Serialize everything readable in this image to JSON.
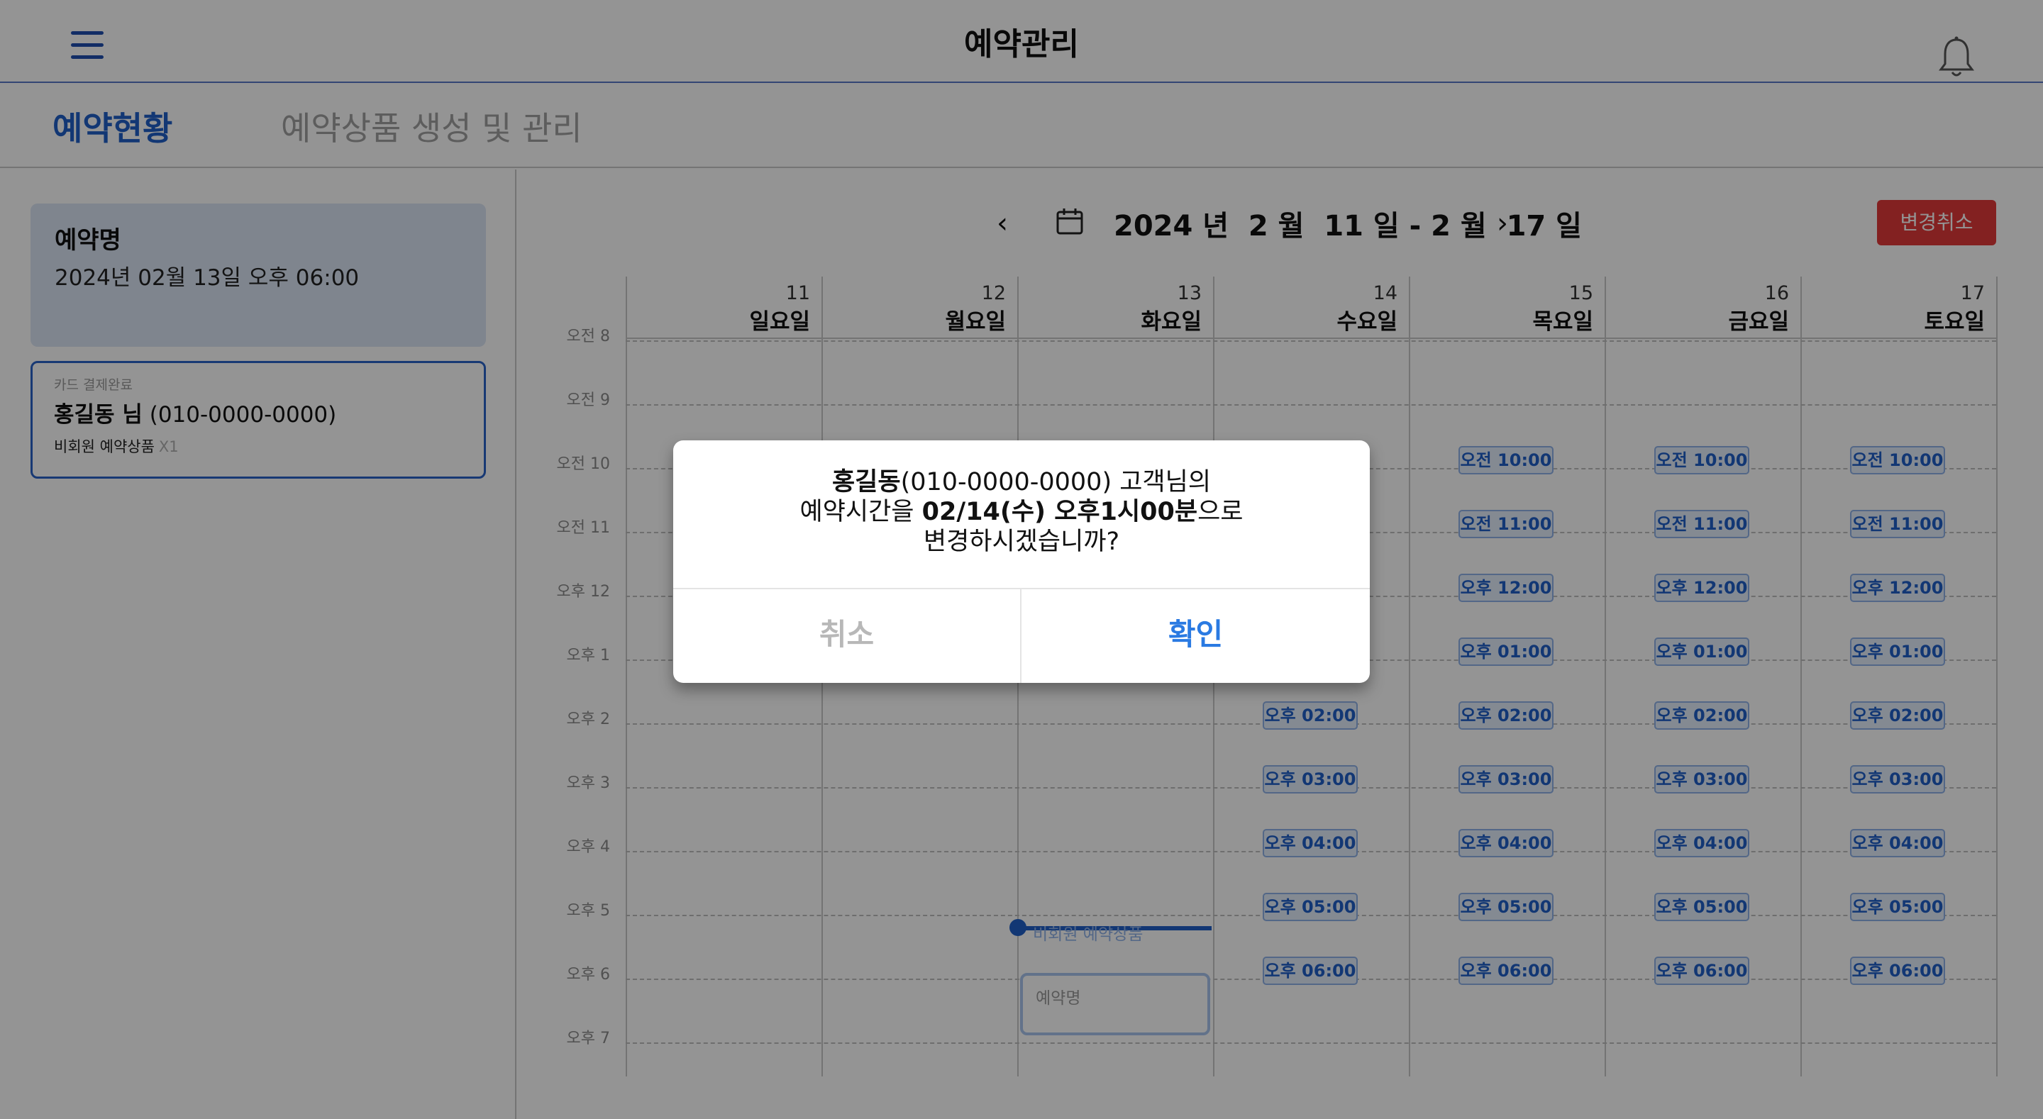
{
  "header": {
    "title": "예약관리",
    "menu_icon": "hamburger-icon",
    "bell_icon": "bell-icon"
  },
  "tabs": [
    {
      "label": "예약현황",
      "active": true
    },
    {
      "label": "예약상품 생성 및 관리",
      "active": false
    }
  ],
  "sidebar": {
    "reservation": {
      "title": "예약명",
      "datetime": "2024년 02월 13일  오후 06:00"
    },
    "customer": {
      "payment_status": "카드 결제완료",
      "name": "홍길동 님",
      "phone": "(010-0000-0000)",
      "product": "비회원 예약상품",
      "quantity": "X1"
    }
  },
  "calendar": {
    "range": "2024 년  2 월  11 일 - 2 월  17 일",
    "cancel_change_label": "변경취소",
    "days": [
      {
        "num": "11",
        "name": "일요일"
      },
      {
        "num": "12",
        "name": "월요일"
      },
      {
        "num": "13",
        "name": "화요일"
      },
      {
        "num": "14",
        "name": "수요일"
      },
      {
        "num": "15",
        "name": "목요일"
      },
      {
        "num": "16",
        "name": "금요일"
      },
      {
        "num": "17",
        "name": "토요일"
      }
    ],
    "hours": [
      "오전 8",
      "오전 9",
      "오전 10",
      "오전 11",
      "오후 12",
      "오후 1",
      "오후 2",
      "오후 3",
      "오후 4",
      "오후 5",
      "오후 6",
      "오후 7"
    ],
    "slots": {
      "wed": [
        "오후 02:00",
        "오후 03:00",
        "오후 04:00",
        "오후 05:00",
        "오후 06:00"
      ],
      "thu": [
        "오전 10:00",
        "오전 11:00",
        "오후 12:00",
        "오후 01:00",
        "오후 02:00",
        "오후 03:00",
        "오후 04:00",
        "오후 05:00",
        "오후 06:00"
      ],
      "fri": [
        "오전 10:00",
        "오전 11:00",
        "오후 12:00",
        "오후 01:00",
        "오후 02:00",
        "오후 03:00",
        "오후 04:00",
        "오후 05:00",
        "오후 06:00"
      ],
      "sat": [
        "오전 10:00",
        "오전 11:00",
        "오후 12:00",
        "오후 01:00",
        "오후 02:00",
        "오후 03:00",
        "오후 04:00",
        "오후 05:00",
        "오후 06:00"
      ]
    },
    "now_marker_label": "비회원 예약상품",
    "drag_box_label": "예약명"
  },
  "dialog": {
    "line1_name": "홍길동",
    "line1_rest": "(010-0000-0000) 고객님의",
    "line2_prefix": "예약시간을 ",
    "line2_time": "02/14(수) 오후1시00분",
    "line2_suffix": "으로",
    "line3": "변경하시겠습니까?",
    "cancel_label": "취소",
    "confirm_label": "확인"
  },
  "colors": {
    "accent": "#1f5fc8",
    "danger": "#e23a3a",
    "confirm": "#2a7ae2"
  }
}
